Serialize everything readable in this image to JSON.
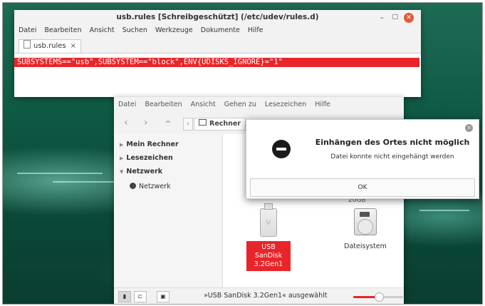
{
  "editor": {
    "title": "usb.rules [Schreibgeschützt] (/etc/udev/rules.d)",
    "minimize": "–",
    "maximize": "□",
    "close": "✕",
    "menu": [
      "Datei",
      "Bearbeiten",
      "Ansicht",
      "Suchen",
      "Werkzeuge",
      "Dokumente",
      "Hilfe"
    ],
    "tab_label": "usb.rules",
    "tab_close": "×",
    "line": "SUBSYSTEMS==\"usb\",SUBSYSTEM==\"block\",ENV{UDISKS_IGNORE}=\"1\""
  },
  "file_manager": {
    "menu": [
      "Datei",
      "Bearbeiten",
      "Ansicht",
      "Gehen zu",
      "Lesezeichen",
      "Hilfe"
    ],
    "nav": {
      "back": "‹",
      "forward": "›",
      "up": "⌃",
      "left": "‹"
    },
    "location": "Rechner",
    "sidebar": [
      {
        "label": "Mein Rechner",
        "expand": "▶"
      },
      {
        "label": "Lesezeichen",
        "expand": "▶"
      },
      {
        "label": "Netzwerk",
        "expand": "▼"
      },
      {
        "label": "Netzwerk"
      }
    ],
    "items": {
      "partial_size": "20GB",
      "usb_label": "USB SanDisk 3.2Gen1",
      "disk_label": "Dateisystem"
    },
    "status": {
      "text": "»USB SanDisk 3.2Gen1« ausgewählt",
      "zoom_level": 0.5,
      "buttons": [
        "▮",
        "⊏",
        "▣"
      ]
    }
  },
  "dialog": {
    "title": "Einhängen des Ortes nicht möglich",
    "message": "Datei konnte nicht eingehängt werden",
    "ok": "OK",
    "close": "×"
  },
  "colors": {
    "accent": "#e8252a",
    "close": "#e25a3a"
  }
}
